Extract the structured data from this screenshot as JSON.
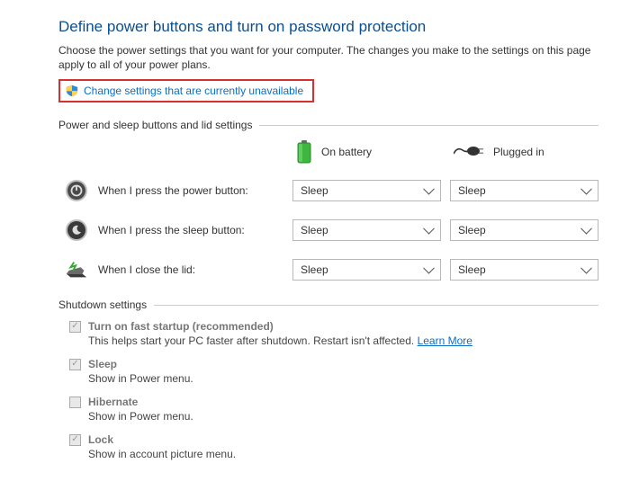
{
  "title": "Define power buttons and turn on password protection",
  "subtitle": "Choose the power settings that you want for your computer. The changes you make to the settings on this page apply to all of your power plans.",
  "changeLink": "Change settings that are currently unavailable",
  "group1": {
    "heading": "Power and sleep buttons and lid settings",
    "batteryLabel": "On battery",
    "pluggedLabel": "Plugged in",
    "rows": [
      {
        "label": "When I press the power button:",
        "battery": "Sleep",
        "plugged": "Sleep"
      },
      {
        "label": "When I press the sleep button:",
        "battery": "Sleep",
        "plugged": "Sleep"
      },
      {
        "label": "When I close the lid:",
        "battery": "Sleep",
        "plugged": "Sleep"
      }
    ]
  },
  "group2": {
    "heading": "Shutdown settings",
    "items": [
      {
        "name": "Turn on fast startup (recommended)",
        "desc": "This helps start your PC faster after shutdown. Restart isn't affected. ",
        "learnMore": "Learn More",
        "checked": true
      },
      {
        "name": "Sleep",
        "desc": "Show in Power menu.",
        "checked": true
      },
      {
        "name": "Hibernate",
        "desc": "Show in Power menu.",
        "checked": false
      },
      {
        "name": "Lock",
        "desc": "Show in account picture menu.",
        "checked": true
      }
    ]
  }
}
